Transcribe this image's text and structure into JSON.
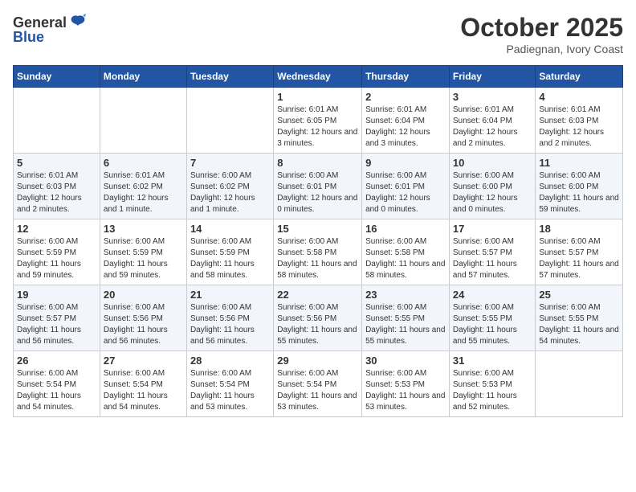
{
  "header": {
    "logo_general": "General",
    "logo_blue": "Blue",
    "month": "October 2025",
    "location": "Padiegnan, Ivory Coast"
  },
  "weekdays": [
    "Sunday",
    "Monday",
    "Tuesday",
    "Wednesday",
    "Thursday",
    "Friday",
    "Saturday"
  ],
  "weeks": [
    [
      {
        "day": "",
        "info": ""
      },
      {
        "day": "",
        "info": ""
      },
      {
        "day": "",
        "info": ""
      },
      {
        "day": "1",
        "info": "Sunrise: 6:01 AM\nSunset: 6:05 PM\nDaylight: 12 hours and 3 minutes."
      },
      {
        "day": "2",
        "info": "Sunrise: 6:01 AM\nSunset: 6:04 PM\nDaylight: 12 hours and 3 minutes."
      },
      {
        "day": "3",
        "info": "Sunrise: 6:01 AM\nSunset: 6:04 PM\nDaylight: 12 hours and 2 minutes."
      },
      {
        "day": "4",
        "info": "Sunrise: 6:01 AM\nSunset: 6:03 PM\nDaylight: 12 hours and 2 minutes."
      }
    ],
    [
      {
        "day": "5",
        "info": "Sunrise: 6:01 AM\nSunset: 6:03 PM\nDaylight: 12 hours and 2 minutes."
      },
      {
        "day": "6",
        "info": "Sunrise: 6:01 AM\nSunset: 6:02 PM\nDaylight: 12 hours and 1 minute."
      },
      {
        "day": "7",
        "info": "Sunrise: 6:00 AM\nSunset: 6:02 PM\nDaylight: 12 hours and 1 minute."
      },
      {
        "day": "8",
        "info": "Sunrise: 6:00 AM\nSunset: 6:01 PM\nDaylight: 12 hours and 0 minutes."
      },
      {
        "day": "9",
        "info": "Sunrise: 6:00 AM\nSunset: 6:01 PM\nDaylight: 12 hours and 0 minutes."
      },
      {
        "day": "10",
        "info": "Sunrise: 6:00 AM\nSunset: 6:00 PM\nDaylight: 12 hours and 0 minutes."
      },
      {
        "day": "11",
        "info": "Sunrise: 6:00 AM\nSunset: 6:00 PM\nDaylight: 11 hours and 59 minutes."
      }
    ],
    [
      {
        "day": "12",
        "info": "Sunrise: 6:00 AM\nSunset: 5:59 PM\nDaylight: 11 hours and 59 minutes."
      },
      {
        "day": "13",
        "info": "Sunrise: 6:00 AM\nSunset: 5:59 PM\nDaylight: 11 hours and 59 minutes."
      },
      {
        "day": "14",
        "info": "Sunrise: 6:00 AM\nSunset: 5:59 PM\nDaylight: 11 hours and 58 minutes."
      },
      {
        "day": "15",
        "info": "Sunrise: 6:00 AM\nSunset: 5:58 PM\nDaylight: 11 hours and 58 minutes."
      },
      {
        "day": "16",
        "info": "Sunrise: 6:00 AM\nSunset: 5:58 PM\nDaylight: 11 hours and 58 minutes."
      },
      {
        "day": "17",
        "info": "Sunrise: 6:00 AM\nSunset: 5:57 PM\nDaylight: 11 hours and 57 minutes."
      },
      {
        "day": "18",
        "info": "Sunrise: 6:00 AM\nSunset: 5:57 PM\nDaylight: 11 hours and 57 minutes."
      }
    ],
    [
      {
        "day": "19",
        "info": "Sunrise: 6:00 AM\nSunset: 5:57 PM\nDaylight: 11 hours and 56 minutes."
      },
      {
        "day": "20",
        "info": "Sunrise: 6:00 AM\nSunset: 5:56 PM\nDaylight: 11 hours and 56 minutes."
      },
      {
        "day": "21",
        "info": "Sunrise: 6:00 AM\nSunset: 5:56 PM\nDaylight: 11 hours and 56 minutes."
      },
      {
        "day": "22",
        "info": "Sunrise: 6:00 AM\nSunset: 5:56 PM\nDaylight: 11 hours and 55 minutes."
      },
      {
        "day": "23",
        "info": "Sunrise: 6:00 AM\nSunset: 5:55 PM\nDaylight: 11 hours and 55 minutes."
      },
      {
        "day": "24",
        "info": "Sunrise: 6:00 AM\nSunset: 5:55 PM\nDaylight: 11 hours and 55 minutes."
      },
      {
        "day": "25",
        "info": "Sunrise: 6:00 AM\nSunset: 5:55 PM\nDaylight: 11 hours and 54 minutes."
      }
    ],
    [
      {
        "day": "26",
        "info": "Sunrise: 6:00 AM\nSunset: 5:54 PM\nDaylight: 11 hours and 54 minutes."
      },
      {
        "day": "27",
        "info": "Sunrise: 6:00 AM\nSunset: 5:54 PM\nDaylight: 11 hours and 54 minutes."
      },
      {
        "day": "28",
        "info": "Sunrise: 6:00 AM\nSunset: 5:54 PM\nDaylight: 11 hours and 53 minutes."
      },
      {
        "day": "29",
        "info": "Sunrise: 6:00 AM\nSunset: 5:54 PM\nDaylight: 11 hours and 53 minutes."
      },
      {
        "day": "30",
        "info": "Sunrise: 6:00 AM\nSunset: 5:53 PM\nDaylight: 11 hours and 53 minutes."
      },
      {
        "day": "31",
        "info": "Sunrise: 6:00 AM\nSunset: 5:53 PM\nDaylight: 11 hours and 52 minutes."
      },
      {
        "day": "",
        "info": ""
      }
    ]
  ]
}
